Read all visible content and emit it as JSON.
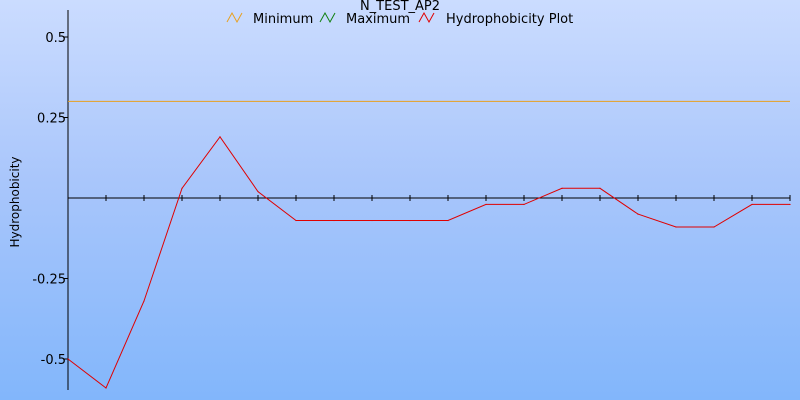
{
  "chart_data": {
    "type": "line",
    "title": "N_TEST_AP2",
    "xlabel": "",
    "ylabel": "Hydrophobicity",
    "ylim": [
      -0.58,
      0.58
    ],
    "y_ticks": [
      0.5,
      0.25,
      -0.25,
      -0.5
    ],
    "y_tick_labels": [
      "0.5",
      "0.25",
      "-0.25",
      "-0.5"
    ],
    "x_count": 20,
    "grid": false,
    "legend_position": "top",
    "series": [
      {
        "name": "Minimum",
        "color": "#e8a020",
        "values": [
          0.3,
          0.3,
          0.3,
          0.3,
          0.3,
          0.3,
          0.3,
          0.3,
          0.3,
          0.3,
          0.3,
          0.3,
          0.3,
          0.3,
          0.3,
          0.3,
          0.3,
          0.3,
          0.3,
          0.3
        ]
      },
      {
        "name": "Maximum",
        "color": "#108010",
        "values": []
      },
      {
        "name": "Hydrophobicity Plot",
        "color": "#e00000",
        "values": [
          -0.5,
          -0.59,
          -0.32,
          0.03,
          0.19,
          0.02,
          -0.07,
          -0.07,
          -0.07,
          -0.07,
          -0.07,
          -0.02,
          -0.02,
          0.03,
          0.03,
          -0.05,
          -0.09,
          -0.09,
          -0.02,
          -0.02
        ]
      }
    ]
  }
}
